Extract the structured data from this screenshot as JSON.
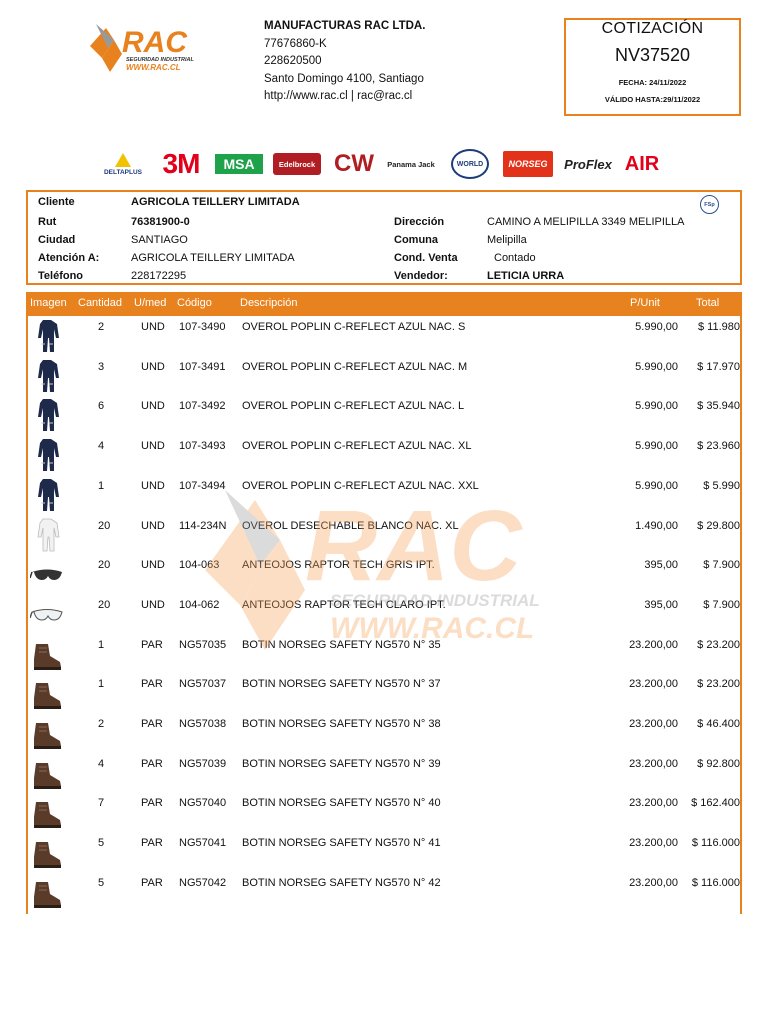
{
  "logo": {
    "brand": "RAC",
    "tagline": "SEGURIDAD INDUSTRIAL",
    "url": "WWW.RAC.CL"
  },
  "company": {
    "name": "MANUFACTURAS RAC LTDA.",
    "rut": "77676860-K",
    "phone": "228620500",
    "address": "Santo Domingo 4100, Santiago",
    "web": "http://www.rac.cl | rac@rac.cl"
  },
  "quote": {
    "title": "COTIZACIÓN",
    "number": "NV37520",
    "date": "FECHA: 24/11/2022",
    "valid": "VÁLIDO HASTA:29/11/2022"
  },
  "brands": [
    "DELTAPLUS",
    "3M",
    "MSA",
    "Edelbrock",
    "CW",
    "Panama Jack",
    "WORLD",
    "NORSEG",
    "ProFlex",
    "AIR"
  ],
  "client": {
    "labels": {
      "cliente": "Cliente",
      "rut": "Rut",
      "ciudad": "Ciudad",
      "atencion": "Atención A:",
      "telefono": "Teléfono",
      "direccion": "Dirección",
      "comuna": "Comuna",
      "cond": "Cond. Venta",
      "vendedor": "Vendedor:"
    },
    "cliente": "AGRICOLA TEILLERY LIMITADA",
    "rut": "76381900-0",
    "ciudad": "SANTIAGO",
    "atencion": "AGRICOLA TEILLERY LIMITADA",
    "telefono": "228172295",
    "direccion": "CAMINO A MELIPILLA 3349 MELIPILLA",
    "comuna": "Melipilla",
    "cond": "Contado",
    "vendedor": "LETICIA URRA",
    "badge": "FSp"
  },
  "table": {
    "headers": {
      "imagen": "Imagen",
      "cantidad": "Cantidad",
      "umed": "U/med",
      "codigo": "Código",
      "descripcion": "Descripción",
      "punit": "P/Unit",
      "total": "Total"
    },
    "rows": [
      {
        "icon": "overall-dark-icon",
        "qty": "2",
        "unit": "UND",
        "code": "107-3490",
        "desc": "OVEROL POPLIN C-REFLECT AZUL NAC. S",
        "price": "5.990,00",
        "total": "$ 11.980"
      },
      {
        "icon": "overall-dark-icon",
        "qty": "3",
        "unit": "UND",
        "code": "107-3491",
        "desc": "OVEROL POPLIN C-REFLECT AZUL NAC. M",
        "price": "5.990,00",
        "total": "$ 17.970"
      },
      {
        "icon": "overall-dark-icon",
        "qty": "6",
        "unit": "UND",
        "code": "107-3492",
        "desc": "OVEROL POPLIN C-REFLECT AZUL NAC. L",
        "price": "5.990,00",
        "total": "$ 35.940"
      },
      {
        "icon": "overall-dark-icon",
        "qty": "4",
        "unit": "UND",
        "code": "107-3493",
        "desc": "OVEROL POPLIN C-REFLECT AZUL NAC. XL",
        "price": "5.990,00",
        "total": "$ 23.960"
      },
      {
        "icon": "overall-dark-icon",
        "qty": "1",
        "unit": "UND",
        "code": "107-3494",
        "desc": "OVEROL POPLIN C-REFLECT AZUL NAC. XXL",
        "price": "5.990,00",
        "total": "$ 5.990"
      },
      {
        "icon": "overall-white-icon",
        "qty": "20",
        "unit": "UND",
        "code": "114-234N",
        "desc": "OVEROL DESECHABLE BLANCO NAC. XL",
        "price": "1.490,00",
        "total": "$ 29.800"
      },
      {
        "icon": "glasses-dark-icon",
        "qty": "20",
        "unit": "UND",
        "code": "104-063",
        "desc": "ANTEOJOS RAPTOR TECH GRIS IPT.",
        "price": "395,00",
        "total": "$ 7.900"
      },
      {
        "icon": "glasses-clear-icon",
        "qty": "20",
        "unit": "UND",
        "code": "104-062",
        "desc": "ANTEOJOS RAPTOR TECH CLARO IPT.",
        "price": "395,00",
        "total": "$ 7.900"
      },
      {
        "icon": "boot-icon",
        "qty": "1",
        "unit": "PAR",
        "code": "NG57035",
        "desc": "BOTIN NORSEG SAFETY NG570 N° 35",
        "price": "23.200,00",
        "total": "$ 23.200"
      },
      {
        "icon": "boot-icon",
        "qty": "1",
        "unit": "PAR",
        "code": "NG57037",
        "desc": "BOTIN NORSEG SAFETY NG570 N° 37",
        "price": "23.200,00",
        "total": "$ 23.200"
      },
      {
        "icon": "boot-icon",
        "qty": "2",
        "unit": "PAR",
        "code": "NG57038",
        "desc": "BOTIN NORSEG SAFETY NG570 N° 38",
        "price": "23.200,00",
        "total": "$ 46.400"
      },
      {
        "icon": "boot-icon",
        "qty": "4",
        "unit": "PAR",
        "code": "NG57039",
        "desc": "BOTIN NORSEG SAFETY NG570 N° 39",
        "price": "23.200,00",
        "total": "$ 92.800"
      },
      {
        "icon": "boot-icon",
        "qty": "7",
        "unit": "PAR",
        "code": "NG57040",
        "desc": "BOTIN NORSEG SAFETY NG570 N° 40",
        "price": "23.200,00",
        "total": "$ 162.400"
      },
      {
        "icon": "boot-icon",
        "qty": "5",
        "unit": "PAR",
        "code": "NG57041",
        "desc": "BOTIN NORSEG SAFETY NG570 N° 41",
        "price": "23.200,00",
        "total": "$ 116.000"
      },
      {
        "icon": "boot-icon",
        "qty": "5",
        "unit": "PAR",
        "code": "NG57042",
        "desc": "BOTIN NORSEG SAFETY NG570 N° 42",
        "price": "23.200,00",
        "total": "$ 116.000"
      }
    ]
  },
  "colors": {
    "accent": "#e8821e",
    "navy": "#1d2a4a",
    "boot": "#5a3b2a"
  }
}
